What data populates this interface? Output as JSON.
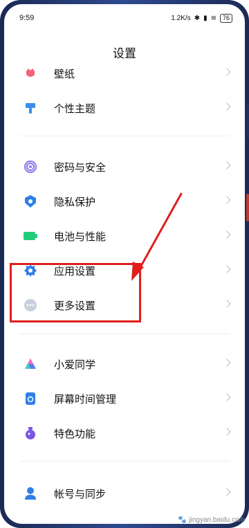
{
  "status_bar": {
    "time": "9:59",
    "net_speed": "1.2K/s",
    "battery": "76"
  },
  "page": {
    "title": "设置"
  },
  "menu": {
    "items": [
      {
        "label": "壁纸",
        "icon": "wallpaper-icon",
        "color": "#f4607a"
      },
      {
        "label": "个性主题",
        "icon": "theme-brush-icon",
        "color": "#3a8ee8"
      },
      {
        "label": "密码与安全",
        "icon": "fingerprint-icon",
        "color": "#8a73f0"
      },
      {
        "label": "隐私保护",
        "icon": "privacy-shield-icon",
        "color": "#2f7fe6"
      },
      {
        "label": "电池与性能",
        "icon": "battery-icon",
        "color": "#22cc7a"
      },
      {
        "label": "应用设置",
        "icon": "gear-icon",
        "color": "#2f7fe6"
      },
      {
        "label": "更多设置",
        "icon": "more-dots-icon",
        "color": "#9aa6bd"
      },
      {
        "label": "小爱同学",
        "icon": "xiaoai-icon",
        "color": "#5a7cf5"
      },
      {
        "label": "屏幕时间管理",
        "icon": "screen-time-icon",
        "color": "#2f7fe6"
      },
      {
        "label": "特色功能",
        "icon": "feature-icon",
        "color": "#7b55e6"
      },
      {
        "label": "帐号与同步",
        "icon": "account-icon",
        "color": "#2f7fe6"
      }
    ]
  },
  "annotation": {
    "highlight_color": "#e11d1d"
  },
  "watermark": {
    "text": "jingyan.baidu.com"
  }
}
